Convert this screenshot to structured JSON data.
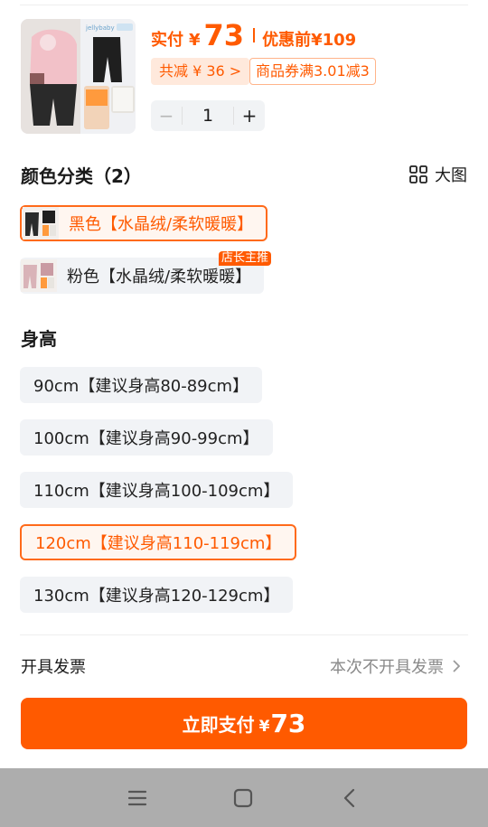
{
  "product": {
    "brand_logo": "jellybaby",
    "price_label": "实付",
    "currency": "¥",
    "price_value": "73",
    "before_label": "优惠前",
    "before_price": "¥109",
    "discount_tag": "共减 ¥ 36 >",
    "coupon_tag": "商品券满3.01减3",
    "quantity": "1",
    "minus_label": "−",
    "plus_label": "+"
  },
  "color_section": {
    "title": "颜色分类（2）",
    "big_view_label": "大图",
    "options": [
      {
        "label": "黑色【水晶绒/柔软暖暖】",
        "selected": true,
        "swatch_color": "#2b2b2b"
      },
      {
        "label": "粉色【水晶绒/柔软暖暖】",
        "selected": false,
        "swatch_color": "#d9b3b8",
        "badge": "店长主推"
      }
    ]
  },
  "height_section": {
    "title": "身高",
    "options": [
      {
        "label": "90cm【建议身高80-89cm】",
        "selected": false
      },
      {
        "label": "100cm【建议身高90-99cm】",
        "selected": false
      },
      {
        "label": "110cm【建议身高100-109cm】",
        "selected": false
      },
      {
        "label": "120cm【建议身高110-119cm】",
        "selected": true
      },
      {
        "label": "130cm【建议身高120-129cm】",
        "selected": false
      }
    ]
  },
  "invoice": {
    "label": "开具发票",
    "value": "本次不开具发票"
  },
  "pay_button": {
    "label": "立即支付",
    "currency": "¥",
    "amount": "73"
  },
  "colors": {
    "accent": "#ff5a00",
    "pill_bg": "#f1f3f6",
    "navbar_bg": "#adadad"
  }
}
